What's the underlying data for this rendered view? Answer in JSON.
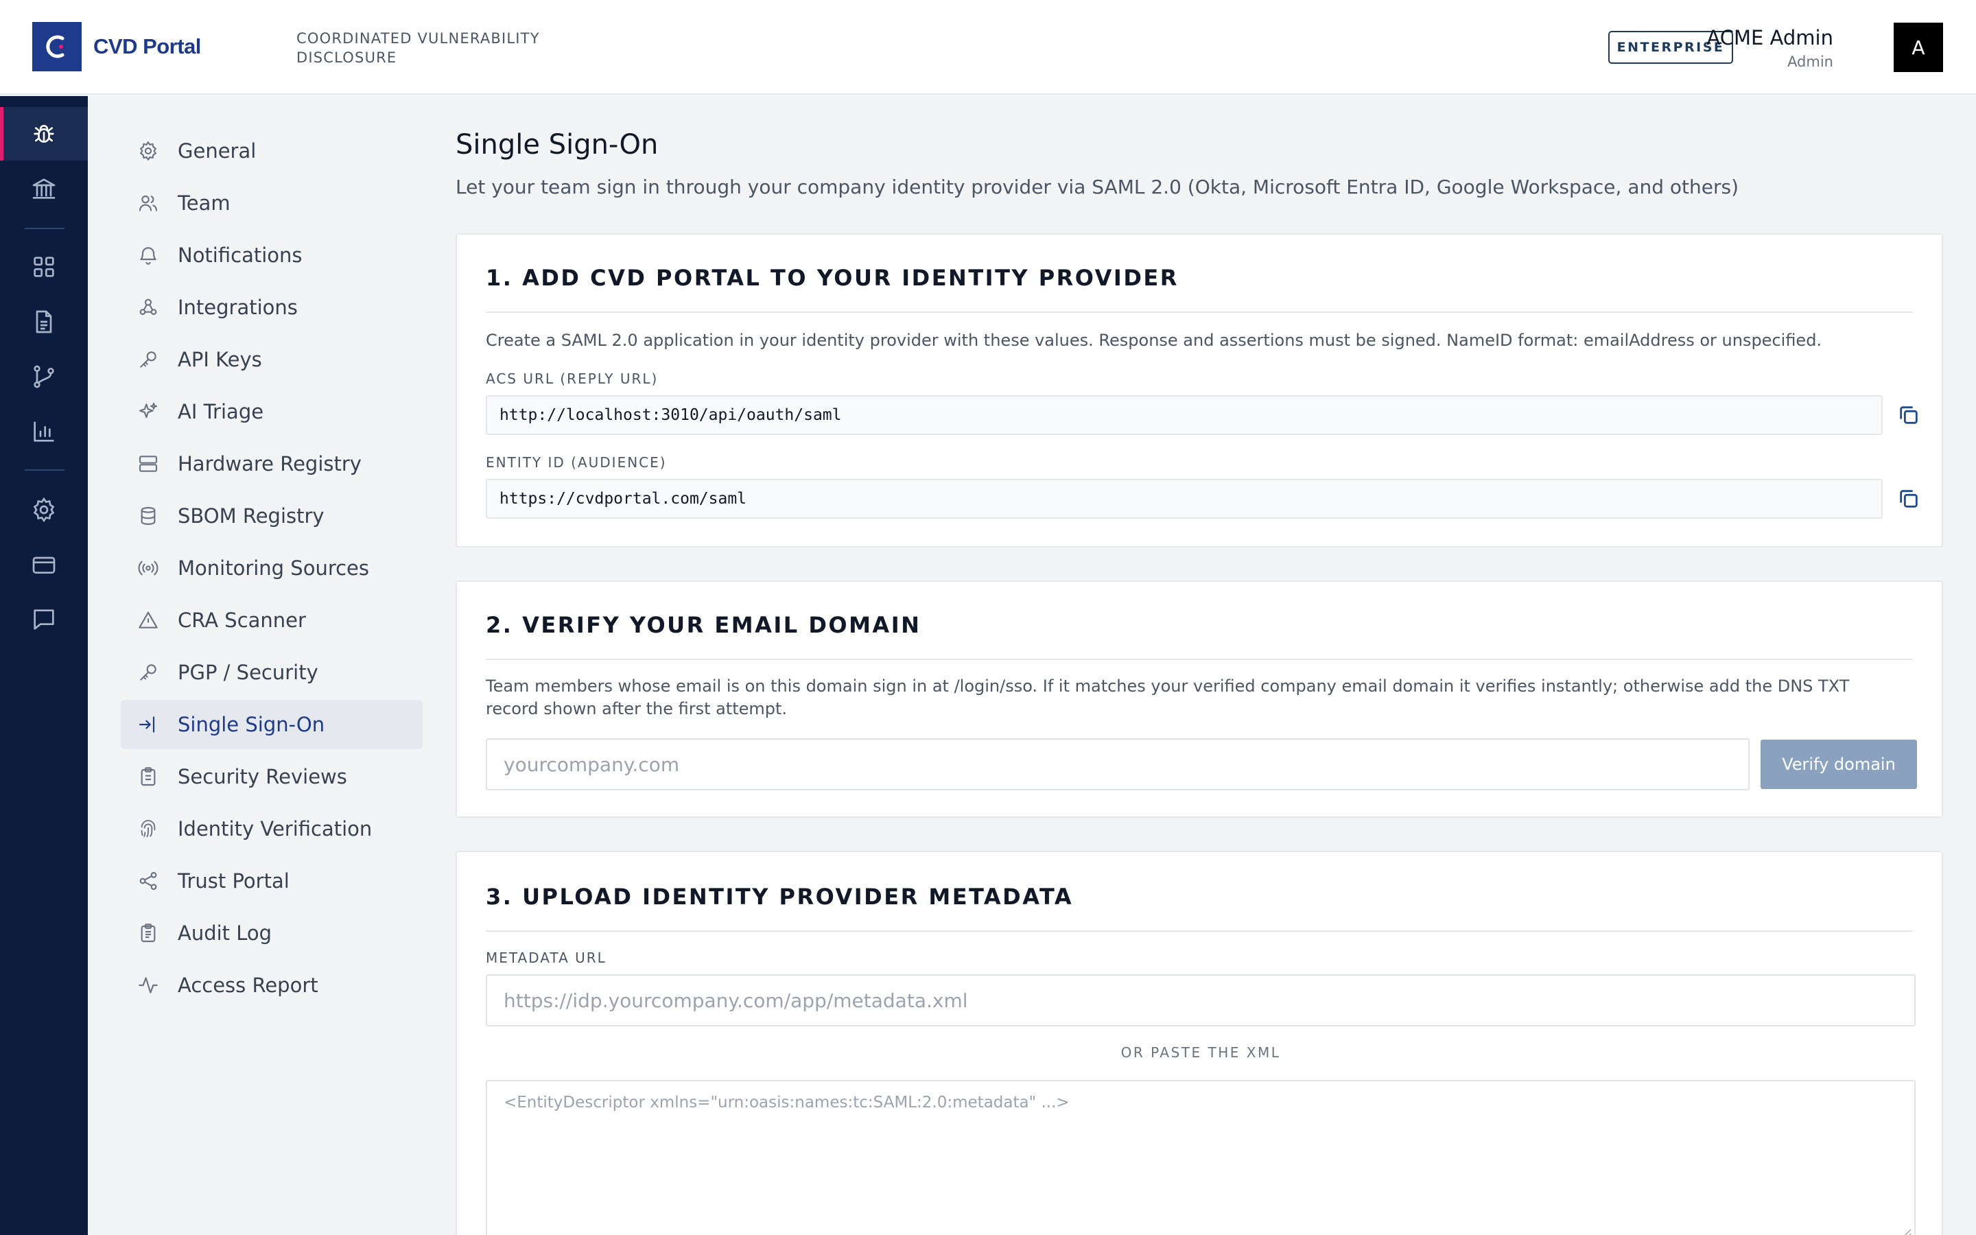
{
  "header": {
    "logo_text": "CVD Portal",
    "tagline": "COORDINATED VULNERABILITY DISCLOSURE",
    "plan_badge": "ENTERPRISE",
    "user_name": "ACME Admin",
    "user_role": "Admin",
    "avatar_initial": "A"
  },
  "rail": {
    "items": [
      {
        "icon": "bug-icon",
        "active": true
      },
      {
        "icon": "bank-icon"
      },
      {
        "icon": "dashboard-icon"
      },
      {
        "icon": "document-icon"
      },
      {
        "icon": "git-branch-icon"
      },
      {
        "icon": "bar-chart-icon"
      },
      {
        "icon": "gear-icon"
      },
      {
        "icon": "credit-card-icon"
      },
      {
        "icon": "chat-icon"
      }
    ]
  },
  "settings_nav": {
    "items": [
      {
        "label": "General",
        "icon": "gear-icon"
      },
      {
        "label": "Team",
        "icon": "users-icon"
      },
      {
        "label": "Notifications",
        "icon": "bell-icon"
      },
      {
        "label": "Integrations",
        "icon": "webhook-icon"
      },
      {
        "label": "API Keys",
        "icon": "key-icon"
      },
      {
        "label": "AI Triage",
        "icon": "sparkles-icon"
      },
      {
        "label": "Hardware Registry",
        "icon": "server-icon"
      },
      {
        "label": "SBOM Registry",
        "icon": "database-icon"
      },
      {
        "label": "Monitoring Sources",
        "icon": "radio-icon"
      },
      {
        "label": "CRA Scanner",
        "icon": "warning-icon"
      },
      {
        "label": "PGP / Security",
        "icon": "key-icon"
      },
      {
        "label": "Single Sign-On",
        "icon": "login-icon",
        "active": true
      },
      {
        "label": "Security Reviews",
        "icon": "clipboard-icon"
      },
      {
        "label": "Identity Verification",
        "icon": "fingerprint-icon"
      },
      {
        "label": "Trust Portal",
        "icon": "share-icon"
      },
      {
        "label": "Audit Log",
        "icon": "clipboard-list-icon"
      },
      {
        "label": "Access Report",
        "icon": "activity-icon"
      }
    ]
  },
  "page": {
    "title": "Single Sign-On",
    "subtitle": "Let your team sign in through your company identity provider via SAML 2.0 (Okta, Microsoft Entra ID, Google Workspace, and others)"
  },
  "step1": {
    "heading": "1. ADD CVD PORTAL TO YOUR IDENTITY PROVIDER",
    "description": "Create a SAML 2.0 application in your identity provider with these values. Response and assertions must be signed. NameID format: emailAddress or unspecified.",
    "acs_label": "ACS URL (REPLY URL)",
    "acs_value": "http://localhost:3010/api/oauth/saml",
    "entity_label": "ENTITY ID (AUDIENCE)",
    "entity_value": "https://cvdportal.com/saml"
  },
  "step2": {
    "heading": "2. VERIFY YOUR EMAIL DOMAIN",
    "description": "Team members whose email is on this domain sign in at /login/sso. If it matches your verified company email domain it verifies instantly; otherwise add the DNS TXT record shown after the first attempt.",
    "domain_placeholder": "yourcompany.com",
    "verify_button": "Verify domain"
  },
  "step3": {
    "heading": "3. UPLOAD IDENTITY PROVIDER METADATA",
    "metadata_label": "METADATA URL",
    "metadata_placeholder": "https://idp.yourcompany.com/app/metadata.xml",
    "or_label": "OR PASTE THE XML",
    "xml_placeholder": "<EntityDescriptor xmlns=\"urn:oasis:names:tc:SAML:2.0:metadata\" ...>"
  },
  "colors": {
    "brand": "#1e3a8a",
    "rail_bg": "#0c1c3e",
    "rail_active_accent": "#e11d74",
    "verify_button_bg": "#8aa2bf",
    "copy_icon": "#1e4b8f"
  }
}
